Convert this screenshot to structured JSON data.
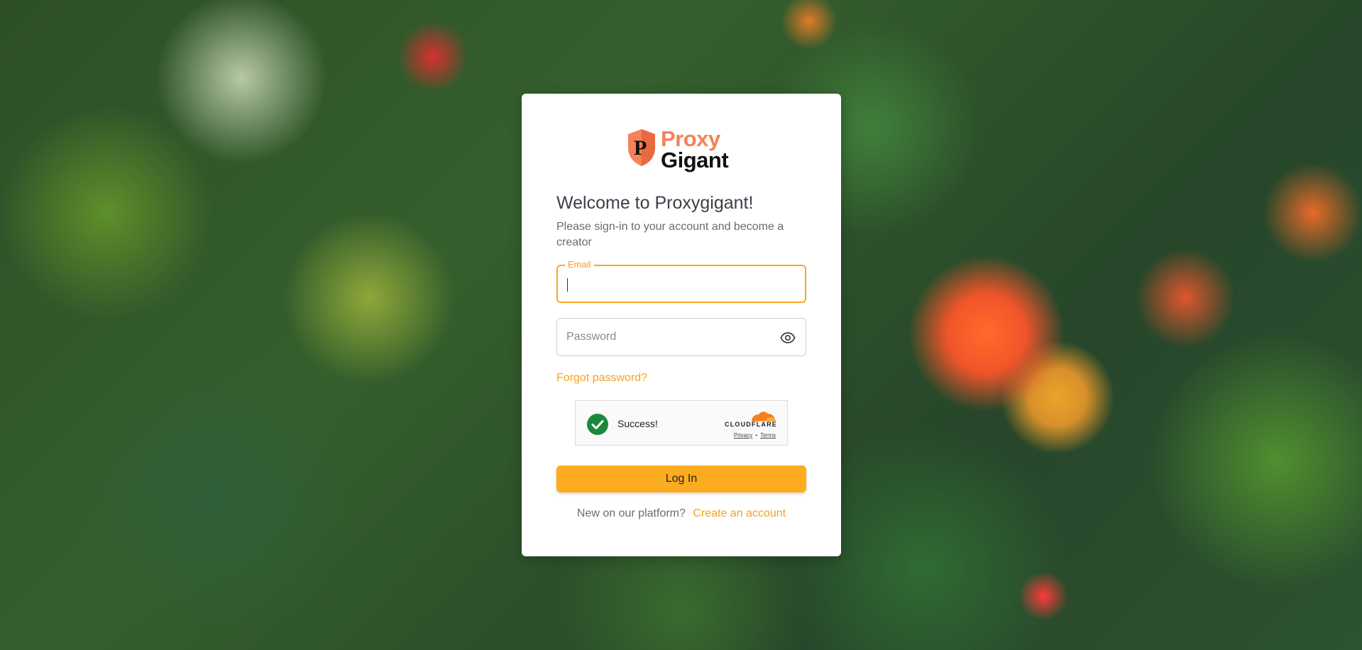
{
  "brand": {
    "name_line_1": "Proxy",
    "name_line_2": "Gigant",
    "accent_color": "#f4825a",
    "primary_color": "#fdab1f"
  },
  "login": {
    "title": "Welcome to Proxygigant!",
    "subtitle": "Please sign-in to your account and become a creator",
    "email": {
      "label": "Email",
      "value": ""
    },
    "password": {
      "placeholder": "Password",
      "value": ""
    },
    "forgot_password": "Forgot password?",
    "submit_label": "Log In",
    "signup_prompt": "New on our platform?",
    "signup_link": "Create an account"
  },
  "captcha": {
    "status": "Success!",
    "provider": "CLOUDFLARE",
    "privacy_link": "Privacy",
    "separator": "•",
    "terms_link": "Terms"
  }
}
